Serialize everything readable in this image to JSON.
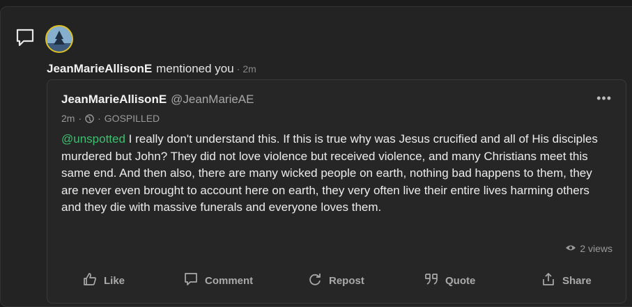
{
  "notification": {
    "username": "JeanMarieAllisonE",
    "action": "mentioned you",
    "separator": "·",
    "time": "2m"
  },
  "post": {
    "author_name": "JeanMarieAllisonE",
    "author_handle": "@JeanMarieAE",
    "more_label": "•••",
    "time": "2m",
    "separator_1": "·",
    "separator_2": "·",
    "group": "GOSPILLED",
    "mention": "@unspotted",
    "text": " I really don't understand this. If this is true why was Jesus crucified and all of His disciples murdered but John? They did not love violence but received violence, and many Christians meet this same end. And then also, there are many wicked people on earth, nothing bad happens to them, they are never even brought to account here on earth, they very often live their entire lives harming others and they die with massive funerals and everyone loves them.",
    "views": "2 views"
  },
  "actions": {
    "like": "Like",
    "comment": "Comment",
    "repost": "Repost",
    "quote": "Quote",
    "share": "Share"
  },
  "colors": {
    "mention": "#3fbf6f",
    "avatar_ring": "#e0c020"
  }
}
